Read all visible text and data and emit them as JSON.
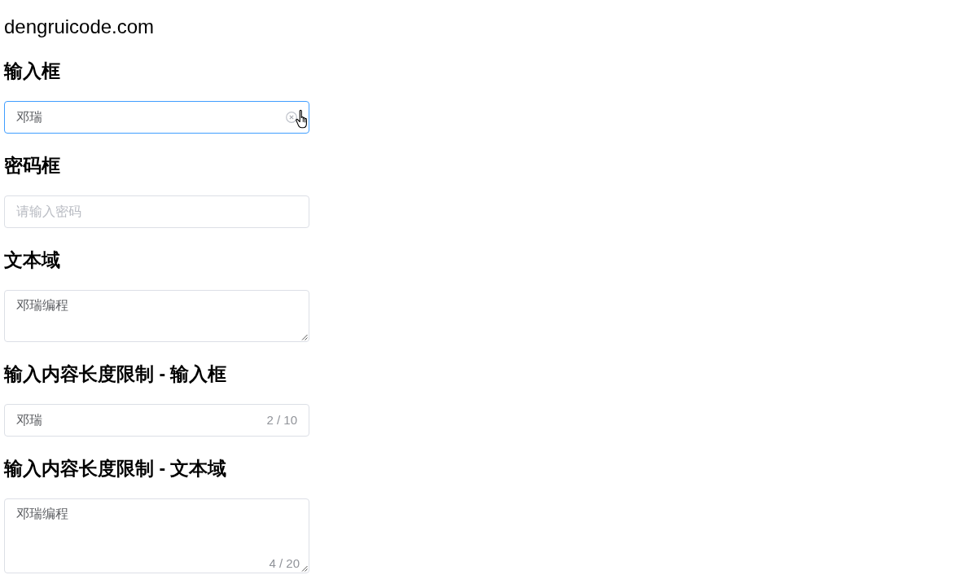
{
  "site_title": "dengruicode.com",
  "sections": [
    {
      "heading": "输入框",
      "field": {
        "kind": "input",
        "value": "邓瑞",
        "focused": true,
        "clearable": true,
        "cursor_over_clear": true
      }
    },
    {
      "heading": "密码框",
      "field": {
        "kind": "password",
        "placeholder": "请输入密码",
        "focused": false
      }
    },
    {
      "heading": "文本域",
      "field": {
        "kind": "textarea",
        "value": "邓瑞编程",
        "focused": false
      }
    },
    {
      "heading": "输入内容长度限制 - 输入框",
      "field": {
        "kind": "input",
        "value": "邓瑞",
        "focused": false,
        "clearable": false,
        "count": "2 / 10"
      }
    },
    {
      "heading": "输入内容长度限制 - 文本域",
      "field": {
        "kind": "textarea",
        "value": "邓瑞编程",
        "focused": false,
        "count": "4 / 20"
      }
    }
  ]
}
